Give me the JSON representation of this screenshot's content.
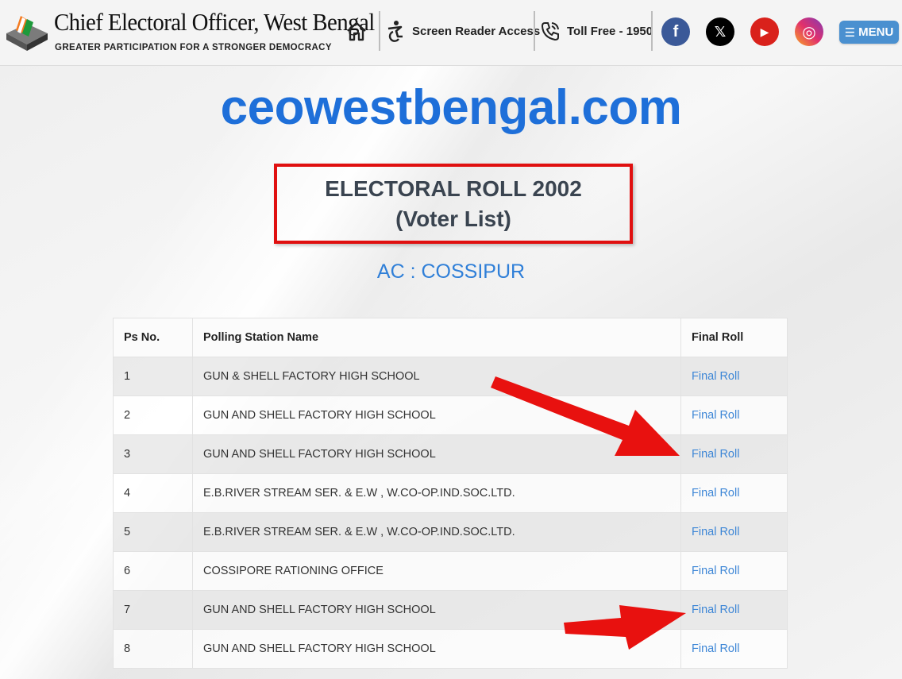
{
  "header": {
    "brand_title": "Chief Electoral Officer, West Bengal",
    "brand_subtitle": "GREATER PARTICIPATION FOR A STRONGER DEMOCRACY",
    "nav": {
      "home_icon": "home-icon",
      "screen_reader": "Screen Reader Access",
      "toll_free": "Toll Free - 1950"
    },
    "social": [
      {
        "name": "facebook-icon",
        "glyph": "f",
        "color": "#3b5998"
      },
      {
        "name": "x-icon",
        "glyph": "𝕏",
        "color": "#000000"
      },
      {
        "name": "youtube-icon",
        "glyph": "▶",
        "color": "#d9211b"
      },
      {
        "name": "instagram-icon",
        "glyph": "◎",
        "color": "#c13584"
      }
    ],
    "menu_label": "MENU",
    "menu_button_color": "#4a90d0"
  },
  "site_title": "ceowestbengal.com",
  "roll": {
    "line1": "ELECTORAL ROLL 2002",
    "line2": "(Voter List)",
    "border_color": "#e01010"
  },
  "ac": "AC : COSSIPUR",
  "table": {
    "headers": [
      "Ps No.",
      "Polling Station Name",
      "Final Roll"
    ],
    "rows": [
      {
        "ps": "1",
        "name": "GUN & SHELL FACTORY HIGH SCHOOL",
        "link": "Final Roll"
      },
      {
        "ps": "2",
        "name": "GUN AND SHELL FACTORY HIGH SCHOOL",
        "link": "Final Roll"
      },
      {
        "ps": "3",
        "name": "GUN AND SHELL FACTORY HIGH SCHOOL",
        "link": "Final Roll"
      },
      {
        "ps": "4",
        "name": "E.B.RIVER STREAM SER. & E.W , W.CO-OP.IND.SOC.LTD.",
        "link": "Final Roll"
      },
      {
        "ps": "5",
        "name": "E.B.RIVER STREAM SER. & E.W , W.CO-OP.IND.SOC.LTD.",
        "link": "Final Roll"
      },
      {
        "ps": "6",
        "name": "COSSIPORE RATIONING OFFICE",
        "link": "Final Roll"
      },
      {
        "ps": "7",
        "name": "GUN AND SHELL FACTORY HIGH SCHOOL",
        "link": "Final Roll"
      },
      {
        "ps": "8",
        "name": "GUN AND SHELL FACTORY HIGH SCHOOL",
        "link": "Final Roll"
      }
    ],
    "link_color": "#3d86d6"
  },
  "annotations": {
    "arrow_color": "#e8110f"
  }
}
